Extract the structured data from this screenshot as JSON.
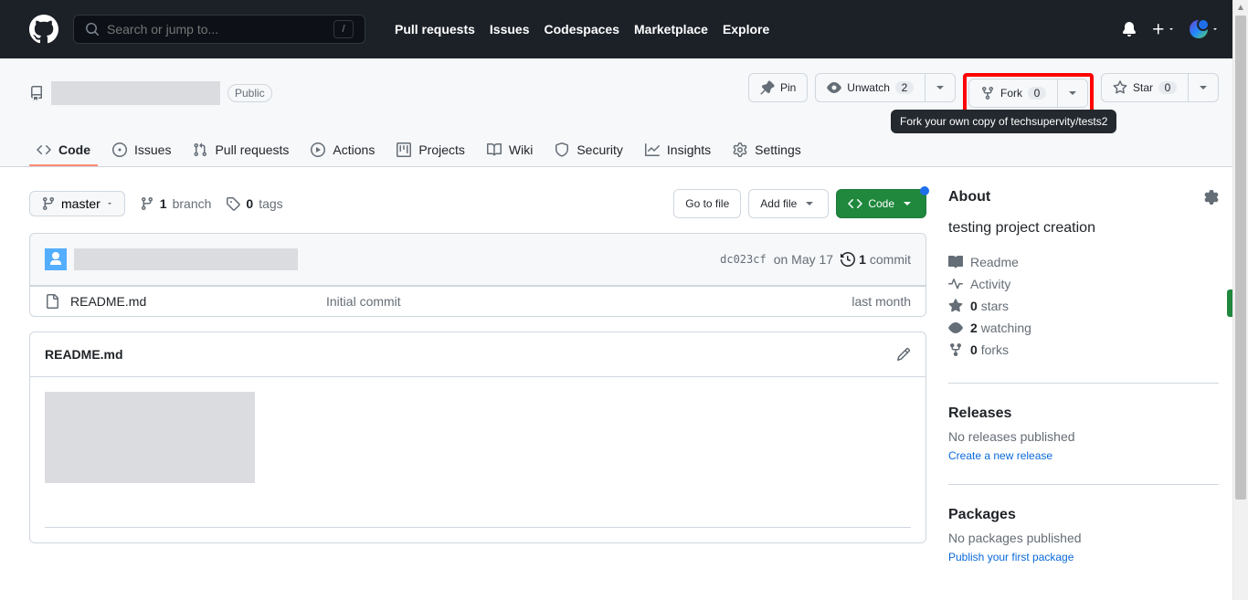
{
  "header": {
    "search_placeholder": "Search or jump to...",
    "nav": [
      "Pull requests",
      "Issues",
      "Codespaces",
      "Marketplace",
      "Explore"
    ]
  },
  "repo": {
    "visibility": "Public",
    "actions": {
      "pin": "Pin",
      "unwatch": "Unwatch",
      "watch_count": "2",
      "fork": "Fork",
      "fork_count": "0",
      "star": "Star",
      "star_count": "0"
    },
    "fork_tooltip": "Fork your own copy of techsupervity/tests2",
    "tabs": {
      "code": "Code",
      "issues": "Issues",
      "pulls": "Pull requests",
      "actions": "Actions",
      "projects": "Projects",
      "wiki": "Wiki",
      "security": "Security",
      "insights": "Insights",
      "settings": "Settings"
    }
  },
  "filenav": {
    "branch": "master",
    "branch_count": "1",
    "branch_label": "branch",
    "tag_count": "0",
    "tag_label": "tags",
    "go_to_file": "Go to file",
    "add_file": "Add file",
    "code_btn": "Code"
  },
  "commit": {
    "sha": "dc023cf",
    "date": "on May 17",
    "count": "1",
    "count_label": "commit"
  },
  "files": [
    {
      "name": "README.md",
      "msg": "Initial commit",
      "time": "last month"
    }
  ],
  "readme": {
    "title": "README.md"
  },
  "about": {
    "title": "About",
    "description": "testing project creation",
    "readme": "Readme",
    "activity": "Activity",
    "stars_count": "0",
    "stars_label": "stars",
    "watching_count": "2",
    "watching_label": "watching",
    "forks_count": "0",
    "forks_label": "forks"
  },
  "releases": {
    "title": "Releases",
    "none": "No releases published",
    "create": "Create a new release"
  },
  "packages": {
    "title": "Packages",
    "none": "No packages published",
    "publish": "Publish your first package"
  }
}
